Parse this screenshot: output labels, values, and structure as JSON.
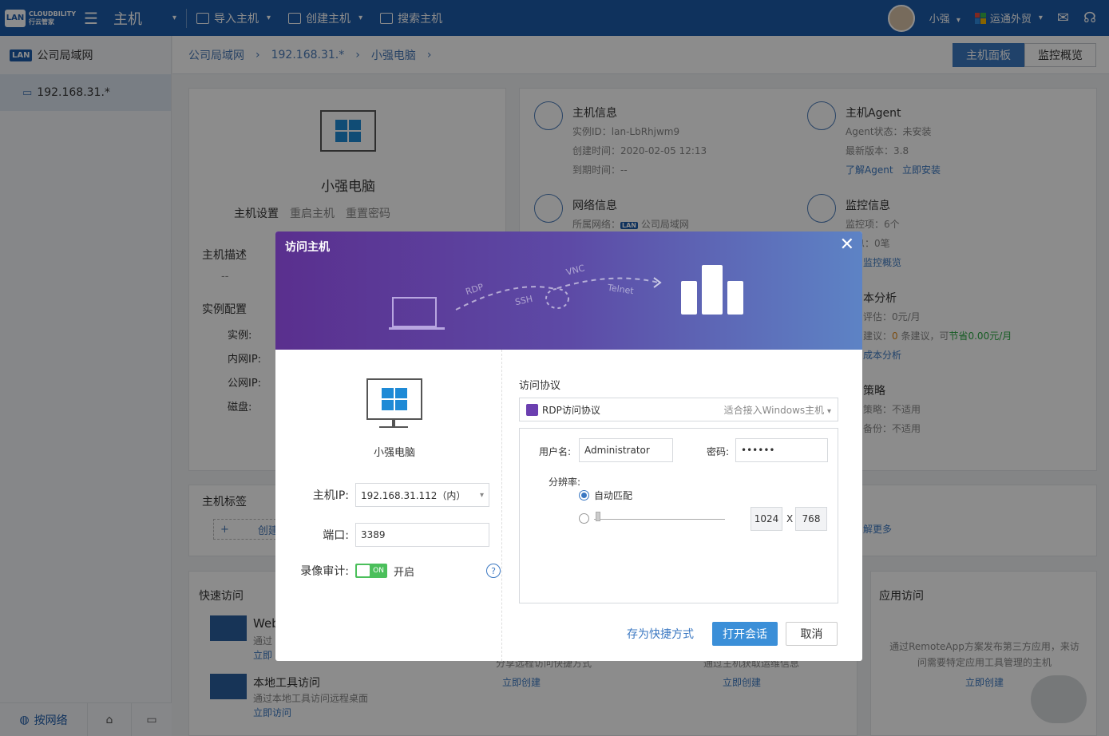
{
  "topbar": {
    "logo_text": "CLOUDBILITY",
    "logo_sub": "行云管家",
    "module": "主机",
    "import_host": "导入主机",
    "create_host": "创建主机",
    "search_host": "搜索主机",
    "user": "小强",
    "org": "运通外贸"
  },
  "sidebar": {
    "network_badge": "LAN",
    "network_name": "公司局域网",
    "selected_item": "192.168.31.*",
    "footer_tab": "按网络"
  },
  "breadcrumb": [
    "公司局域网",
    "192.168.31.*",
    "小强电脑"
  ],
  "view_tabs": [
    "主机面板",
    "监控概览"
  ],
  "host_card": {
    "name": "小强电脑",
    "actions": [
      "主机设置",
      "重启主机",
      "重置密码"
    ],
    "desc_label": "主机描述",
    "desc_value": "--",
    "config_label": "实例配置",
    "config_items": [
      "实例:",
      "内网IP:",
      "公网IP:",
      "磁盘:"
    ]
  },
  "info": {
    "host_info_title": "主机信息",
    "instance_id": "实例ID：lan-LbRhjwm9",
    "created": "创建时间：2020-02-05 12:13",
    "expire": "到期时间：--",
    "agent_title": "主机Agent",
    "agent_status": "Agent状态：未安装",
    "agent_version": "最新版本：3.8",
    "agent_learn": "了解Agent",
    "agent_install": "立即安装",
    "net_title": "网络信息",
    "net_owner_label": "所属网络：",
    "net_owner_name": "公司局域网",
    "mon_title": "监控信息",
    "mon_items": "监控项：6个",
    "mon_msgs": "息：0笔",
    "mon_link": "监控概览",
    "cost_title": "本分析",
    "cost_eval": "评估：0元/月",
    "cost_suggest_prefix": "建议：",
    "cost_suggest_count": "0",
    "cost_suggest_mid": " 条建议，可",
    "cost_suggest_save": "节省0.00元/月",
    "cost_link": "成本分析",
    "backup_title": "策略",
    "backup_line1": "策略：不适用",
    "backup_line2": "备份：不适用",
    "more_link": "解更多"
  },
  "tags": {
    "title": "主机标签",
    "create": "创建"
  },
  "quick": {
    "title": "快速访问",
    "web_title": "Web",
    "web_desc": "通过",
    "web_link": "立即",
    "local_title": "本地工具访问",
    "local_desc": "通过本地工具访问远程桌面",
    "local_link": "立即访问",
    "mid_desc1": "分享远程访问快捷方式",
    "mid_desc2": "通过主机获取运维信息",
    "create_link": "立即创建"
  },
  "app_access": {
    "title": "应用访问",
    "desc": "通过RemoteApp方案发布第三方应用，来访问需要特定应用工具管理的主机",
    "link": "立即创建"
  },
  "modal": {
    "title": "访问主机",
    "protocols_art": [
      "RDP",
      "SSH",
      "VNC",
      "Telnet"
    ],
    "host_name": "小强电脑",
    "ip_label": "主机IP:",
    "ip_value": "192.168.31.112（内）",
    "port_label": "端口:",
    "port_value": "3389",
    "record_label": "录像审计:",
    "record_toggle": "ON",
    "record_state": "开启",
    "help": "?",
    "protocol_label": "访问协议",
    "protocol_value": "RDP访问协议",
    "protocol_hint": "适合接入Windows主机",
    "user_label": "用户名:",
    "user_value": "Administrator",
    "pwd_label": "密码:",
    "pwd_value": "••••••",
    "res_label": "分辨率:",
    "res_auto": "自动匹配",
    "res_w": "1024",
    "res_x": "X",
    "res_h": "768",
    "save_shortcut": "存为快捷方式",
    "open_session": "打开会话",
    "cancel": "取消"
  },
  "colors": {
    "topbar": "#1d5ba9",
    "accent": "#3b78c2",
    "save_green": "#2aa843"
  }
}
